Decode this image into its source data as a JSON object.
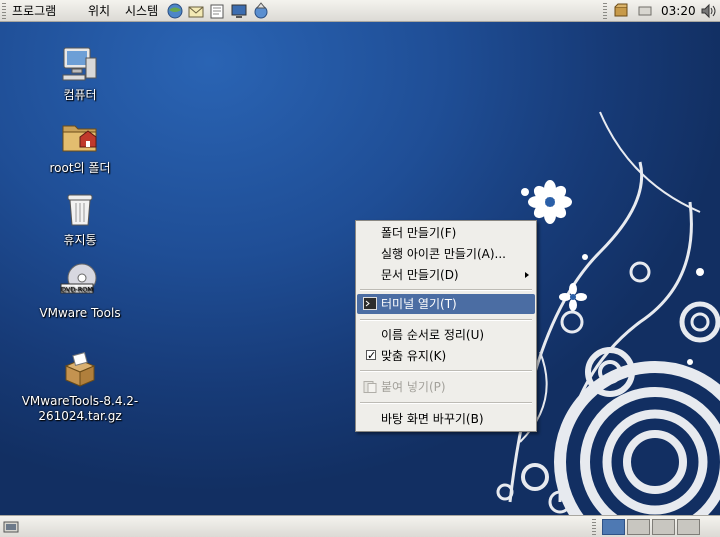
{
  "top_panel": {
    "menus": [
      "프로그램",
      "위치",
      "시스템"
    ],
    "clock": "03:20",
    "launchers": [
      "web-browser-icon",
      "email-icon",
      "text-editor-icon",
      "screenshot-icon",
      "update-icon"
    ],
    "tray": [
      "package-icon",
      "keyboard-icon",
      "volume-icon"
    ]
  },
  "desktop_icons": [
    {
      "label": "컴퓨터",
      "icon": "computer-icon"
    },
    {
      "label": "root의 폴더",
      "icon": "home-folder-icon"
    },
    {
      "label": "휴지통",
      "icon": "trash-icon"
    },
    {
      "label": "VMware Tools",
      "icon": "dvd-icon",
      "disc_text": "DVD-ROM"
    },
    {
      "label_line1": "VMwareTools-8.4.2-",
      "label_line2": "261024.tar.gz",
      "icon": "archive-icon"
    }
  ],
  "context_menu": {
    "items": [
      {
        "label": "폴더 만들기(F)",
        "state": "normal"
      },
      {
        "label": "실행 아이콘 만들기(A)...",
        "state": "normal"
      },
      {
        "label": "문서 만들기(D)",
        "state": "normal",
        "submenu": true
      },
      {
        "label": "터미널 열기(T)",
        "state": "highlighted",
        "icon": "terminal-icon"
      },
      {
        "label": "이름 순서로 정리(U)",
        "state": "normal"
      },
      {
        "label": "맞춤 유지(K)",
        "state": "checked"
      },
      {
        "label": "붙여 넣기(P)",
        "state": "disabled",
        "icon": "paste-icon"
      },
      {
        "label": "바탕 화면 바꾸기(B)",
        "state": "normal"
      }
    ]
  },
  "bottom_panel": {
    "workspaces": 4,
    "active_workspace": 1
  },
  "colors": {
    "desktop_blue": "#1e4a8c",
    "menu_highlight": "#4b6da3",
    "panel_bg": "#dcdad5"
  }
}
